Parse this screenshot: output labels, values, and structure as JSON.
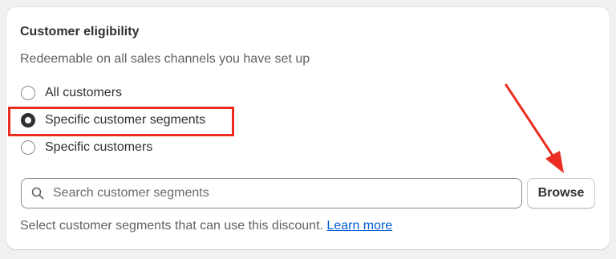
{
  "section": {
    "title": "Customer eligibility",
    "subtitle": "Redeemable on all sales channels you have set up"
  },
  "options": [
    {
      "label": "All customers",
      "checked": false
    },
    {
      "label": "Specific customer segments",
      "checked": true
    },
    {
      "label": "Specific customers",
      "checked": false
    }
  ],
  "search": {
    "placeholder": "Search customer segments",
    "value": ""
  },
  "browse_label": "Browse",
  "help": {
    "text": "Select customer segments that can use this discount.",
    "link_label": "Learn more"
  },
  "colors": {
    "annotation": "#ea2c21",
    "link": "#005bd3",
    "text": "#303030",
    "muted": "#616161"
  }
}
